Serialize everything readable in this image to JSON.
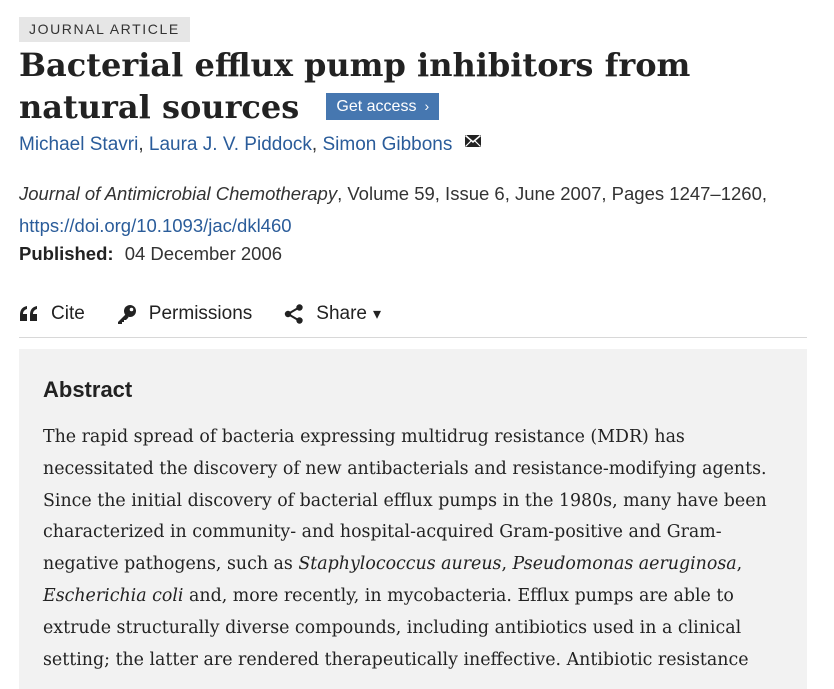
{
  "article": {
    "type_badge": "JOURNAL ARTICLE",
    "title": "Bacterial efflux pump inhibitors from natural sources",
    "get_access": "Get access",
    "authors": [
      "Michael Stavri",
      "Laura J. V. Piddock",
      "Simon Gibbons"
    ],
    "author_sep": ", ",
    "journal": "Journal of Antimicrobial Chemotherapy",
    "citation_rest": ", Volume 59, Issue 6, June 2007, Pages 1247–1260, ",
    "doi": "https://doi.org/10.1093/jac/dkl460",
    "published_label": "Published:",
    "published_date": "04 December 2006"
  },
  "toolbar": {
    "cite": "Cite",
    "permissions": "Permissions",
    "share": "Share",
    "share_caret": "▾"
  },
  "abstract": {
    "heading": "Abstract",
    "p1": "The rapid spread of bacteria expressing multidrug resistance (MDR) has necessitated the discovery of new antibacterials and resistance-modifying agents. Since the initial discovery of bacterial efflux pumps in the 1980s, many have been characterized in community- and hospital-acquired Gram-positive and Gram-negative pathogens, such as ",
    "species1": "Staphylococcus aureus",
    "sep1": ", ",
    "species2": "Pseudomonas aeruginosa",
    "sep2": ", ",
    "species3": "Escherichia coli",
    "p2": " and, more recently, in mycobacteria. Efflux pumps are able to extrude structurally diverse compounds, including antibiotics used in a clinical setting; the latter are rendered therapeutically ineffective. Antibiotic resistance"
  },
  "colors": {
    "link": "#2a5c9a",
    "access_button": "#4677b0",
    "abstract_bg": "#f2f2f2",
    "badge_bg": "#e6e6e6"
  },
  "icons": [
    "mail-icon",
    "quote-icon",
    "key-icon",
    "share-icon",
    "chevron-right-icon"
  ]
}
